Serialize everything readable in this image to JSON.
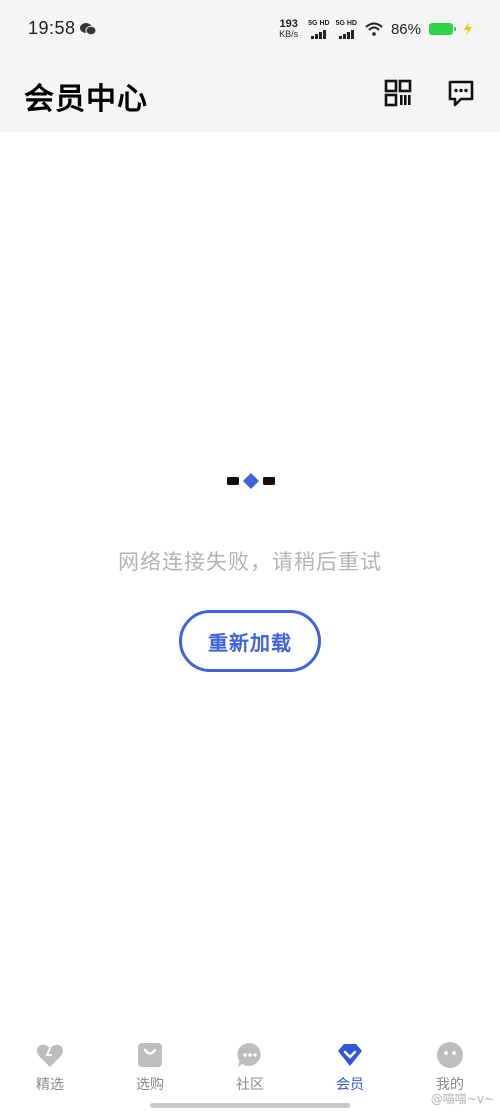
{
  "status_bar": {
    "time": "19:58",
    "net_speed_value": "193",
    "net_speed_unit": "KB/s",
    "sim1": "5G HD",
    "sim2": "5G HD",
    "battery_percent": "86%",
    "battery_color": "#2fd34a"
  },
  "header": {
    "title": "会员中心",
    "icons": [
      "qr-code-icon",
      "message-icon"
    ]
  },
  "main": {
    "error_message": "网络连接失败，请稍后重试",
    "reload_label": "重新加载",
    "accent_color": "#3e63dd"
  },
  "bottom_nav": {
    "items": [
      {
        "label": "精选",
        "icon": "heart-icon",
        "active": false
      },
      {
        "label": "选购",
        "icon": "shopping-bag-icon",
        "active": false
      },
      {
        "label": "社区",
        "icon": "chat-bubble-icon",
        "active": false
      },
      {
        "label": "会员",
        "icon": "vip-diamond-icon",
        "active": true
      },
      {
        "label": "我的",
        "icon": "profile-icon",
        "active": false
      }
    ],
    "active_color": "#2f56d8",
    "inactive_color": "#bdbdbd"
  },
  "watermark": "@喵喵~v~"
}
